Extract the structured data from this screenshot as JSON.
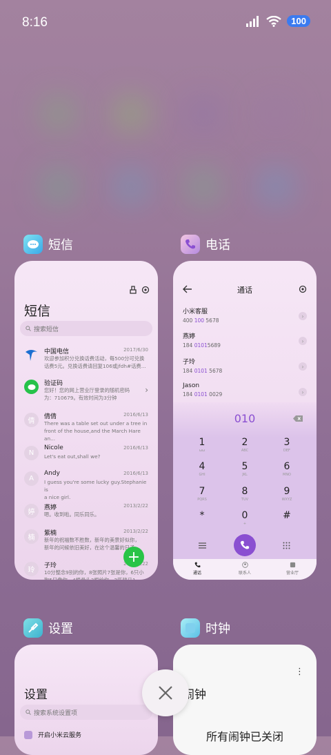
{
  "status_bar": {
    "time": "8:16",
    "battery": "100"
  },
  "apps": {
    "messages": {
      "name": "短信",
      "title": "短信",
      "search_placeholder": "搜索短信",
      "items": [
        {
          "avatar": "",
          "name": "中国电信",
          "date": "2017/6/30",
          "preview": "欢迎参加积分兑换话费活动，每500分可兑换\n话费5元。兑换话费请回复106或jfdh#话费..."
        },
        {
          "avatar": "",
          "name": "验证码",
          "date": "",
          "preview": "您好！您的网上营业厅登录的随机密码\n为：710679。有效时间为3分钟"
        },
        {
          "avatar": "倩",
          "name": "倩倩",
          "date": "2016/6/13",
          "preview": "There was a table set out under a tree in\nfront of the house,and the March Hare an..."
        },
        {
          "avatar": "N",
          "name": "Nicole",
          "date": "2016/6/13",
          "preview": "Let's eat out,shall we?"
        },
        {
          "avatar": "A",
          "name": "Andy",
          "date": "2016/6/13",
          "preview": "I guess you're some lucky guy.Stephanie is\na nice girl."
        },
        {
          "avatar": "婷",
          "name": "燕婷",
          "date": "2013/2/22",
          "preview": "嗯。收到啦。同乐同乐。"
        },
        {
          "avatar": "楠",
          "name": "紫楠",
          "date": "2013/2/22",
          "preview": "新年的祝福数不胜数，新年的美景好似你，\n新年的问候依旧美好，在这个温馨的日子..."
        },
        {
          "avatar": "玲",
          "name": "子玲",
          "date": "2013/2/22",
          "preview": "10分整念9别的你，8张照片7张是你，6只小\n狗5只像你，4根骨头3根给你，2匹骏马1..."
        }
      ]
    },
    "phone": {
      "name": "电话",
      "title": "通话",
      "contacts": [
        {
          "name": "小米客服",
          "num_a": "400 ",
          "num_hi": "100",
          "num_b": " 5678"
        },
        {
          "name": "燕婷",
          "num_a": "184 ",
          "num_hi": "0101",
          "num_b": "5689"
        },
        {
          "name": "子玲",
          "num_a": "184 ",
          "num_hi": "0101",
          "num_b": " 5678"
        },
        {
          "name": "Jason",
          "num_a": "184 ",
          "num_hi": "0101",
          "num_b": " 0029"
        }
      ],
      "dial_input": "010",
      "keys": [
        {
          "d": "1",
          "l": "ωω"
        },
        {
          "d": "2",
          "l": "ABC"
        },
        {
          "d": "3",
          "l": "DEF"
        },
        {
          "d": "4",
          "l": "GHI"
        },
        {
          "d": "5",
          "l": "JKL"
        },
        {
          "d": "6",
          "l": "MNO"
        },
        {
          "d": "7",
          "l": "PQRS"
        },
        {
          "d": "8",
          "l": "TUV"
        },
        {
          "d": "9",
          "l": "WXYZ"
        },
        {
          "d": "*",
          "l": ""
        },
        {
          "d": "0",
          "l": "+"
        },
        {
          "d": "#",
          "l": ""
        }
      ],
      "tabs": [
        "通话",
        "联系人",
        "营业厅"
      ]
    },
    "settings": {
      "name": "设置",
      "title": "设置",
      "search_placeholder": "搜索系统设置项",
      "first_item": "开启小米云服务"
    },
    "clock": {
      "name": "时钟",
      "title": "闹钟",
      "status": "所有闹钟已关闭"
    }
  },
  "colors": {
    "accent": "#8a4fd1",
    "fab": "#29c447"
  }
}
